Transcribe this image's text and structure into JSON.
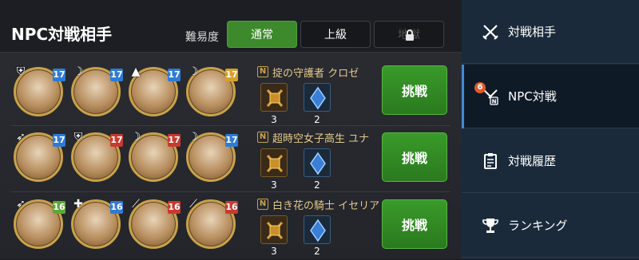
{
  "header": {
    "title": "NPC対戦相手",
    "difficulty_label": "難易度",
    "difficulty_options": [
      {
        "label": "通常",
        "state": "selected"
      },
      {
        "label": "上級",
        "state": "normal"
      },
      {
        "label": "地獄",
        "state": "locked"
      }
    ]
  },
  "opponents": [
    {
      "npc_name": "掟の守護者 クロゼ",
      "members": [
        {
          "role_icon": "shield-icon",
          "level": "17",
          "level_color": "blue"
        },
        {
          "role_icon": "scythe-icon",
          "level": "17",
          "level_color": "blue"
        },
        {
          "role_icon": "witch-hat-icon",
          "level": "17",
          "level_color": "blue"
        },
        {
          "role_icon": "scythe-icon",
          "level": "17",
          "level_color": "gold"
        }
      ],
      "rewards": [
        {
          "icon": "medal-icon",
          "count": "3"
        },
        {
          "icon": "blue-gem-icon",
          "count": "2"
        }
      ],
      "challenge_label": "挑戦"
    },
    {
      "npc_name": "超時空女子高生 ユナ",
      "members": [
        {
          "role_icon": "bow-icon",
          "level": "17",
          "level_color": "blue"
        },
        {
          "role_icon": "shield-icon",
          "level": "17",
          "level_color": "red"
        },
        {
          "role_icon": "scythe-icon",
          "level": "17",
          "level_color": "red"
        },
        {
          "role_icon": "scythe-icon",
          "level": "17",
          "level_color": "blue"
        }
      ],
      "rewards": [
        {
          "icon": "medal-icon",
          "count": "3"
        },
        {
          "icon": "blue-gem-icon",
          "count": "2"
        }
      ],
      "challenge_label": "挑戦"
    },
    {
      "npc_name": "白き花の騎士 イセリア",
      "members": [
        {
          "role_icon": "bow-icon",
          "level": "16",
          "level_color": "green"
        },
        {
          "role_icon": "healer-icon",
          "level": "16",
          "level_color": "blue"
        },
        {
          "role_icon": "spear-icon",
          "level": "16",
          "level_color": "red"
        },
        {
          "role_icon": "spear-icon",
          "level": "16",
          "level_color": "red"
        }
      ],
      "rewards": [
        {
          "icon": "medal-icon",
          "count": "3"
        },
        {
          "icon": "blue-gem-icon",
          "count": "2"
        }
      ],
      "challenge_label": "挑戦"
    }
  ],
  "sidebar": {
    "items": [
      {
        "label": "対戦相手",
        "icon": "crossed-swords-icon",
        "active": false
      },
      {
        "label": "NPC対戦",
        "icon": "npc-battle-icon",
        "active": true,
        "badge": "6"
      },
      {
        "label": "対戦履歴",
        "icon": "clipboard-icon",
        "active": false
      },
      {
        "label": "ランキング",
        "icon": "trophy-icon",
        "active": false
      }
    ]
  },
  "colors": {
    "accent_green": "#3c8a2b",
    "sidebar_bg": "#1b2a3b",
    "active_accent": "#3f8ad8",
    "notification": "#e05a2a"
  }
}
